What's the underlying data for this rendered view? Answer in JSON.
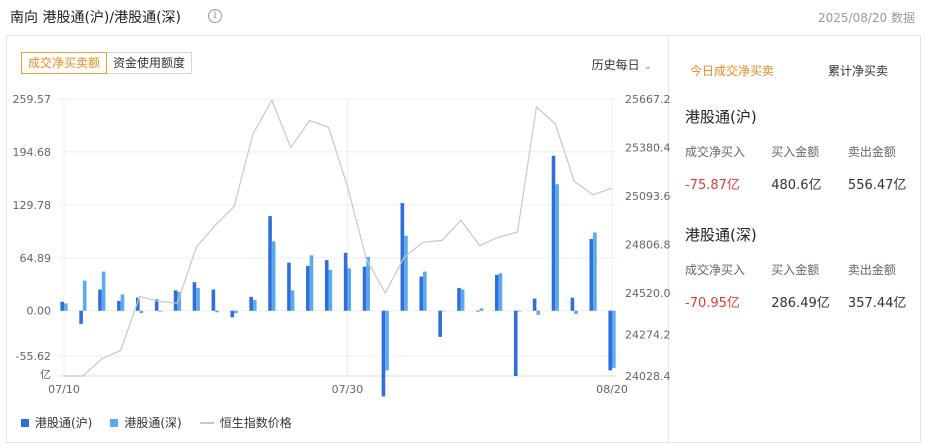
{
  "header": {
    "title": "南向 港股通(沪)/港股通(深)",
    "info": "i",
    "date_note": "2025/08/20 数据"
  },
  "tabs": [
    {
      "label": "成交净买卖额",
      "active": true
    },
    {
      "label": "资金使用额度",
      "active": false
    }
  ],
  "period": {
    "label": "历史每日"
  },
  "right_tabs": [
    {
      "label": "今日成交净买卖",
      "active": true
    },
    {
      "label": "累计净买卖",
      "active": false
    }
  ],
  "markets": [
    {
      "name": "港股通(沪)",
      "net_label": "成交净买入",
      "buy_label": "买入金额",
      "sell_label": "卖出金额",
      "net": "-75.87亿",
      "buy": "480.6亿",
      "sell": "556.47亿"
    },
    {
      "name": "港股通(深)",
      "net_label": "成交净买入",
      "buy_label": "买入金额",
      "sell_label": "卖出金额",
      "net": "-70.95亿",
      "buy": "286.49亿",
      "sell": "357.44亿"
    }
  ],
  "colors": {
    "sh": "#2f6fdc",
    "sz": "#5aaaf0",
    "index": "#c8c8c8",
    "accent": "#f08a1c",
    "negative": "#e23b3b"
  },
  "chart_data": {
    "type": "bar",
    "left_unit": "亿",
    "left_ticks": [
      "259.57",
      "194.68",
      "129.78",
      "64.89",
      "0.00",
      "-55.62"
    ],
    "right_ticks": [
      "25667.2",
      "25380.4",
      "25093.6",
      "24806.8",
      "24520.0",
      "24274.2",
      "24028.4"
    ],
    "x_ticks": [
      "07/10",
      "07/30",
      "08/20"
    ],
    "ylim": [
      -80,
      259.57
    ],
    "y2lim": [
      24028.4,
      25667.2
    ],
    "series": [
      {
        "name": "港股通(沪)",
        "values": [
          11,
          -16,
          26,
          12,
          16,
          14,
          25,
          35,
          26,
          -8,
          17,
          116,
          59,
          55,
          62,
          71,
          54,
          -105,
          132,
          42,
          -32,
          28,
          -1,
          44,
          -80,
          15,
          190,
          16,
          88,
          -73
        ]
      },
      {
        "name": "港股通(深)",
        "values": [
          9,
          37,
          48,
          20,
          -3,
          -1,
          23,
          28,
          -2,
          -3,
          13,
          85,
          25,
          68,
          50,
          52,
          66,
          -73,
          92,
          48,
          0,
          26,
          3,
          46,
          -1,
          -5,
          155,
          -4,
          96,
          -70
        ]
      },
      {
        "name": "恒生指数价格",
        "values": [
          24028.4,
          24028.4,
          24130,
          24180,
          24500,
          24470,
          24460,
          24790,
          24920,
          25030,
          25460,
          25660,
          25380,
          25540,
          25500,
          25150,
          24720,
          24520,
          24730,
          24820,
          24830,
          24950,
          24800,
          24850,
          24880,
          25620,
          25520,
          25180,
          25100,
          25140
        ]
      }
    ]
  }
}
